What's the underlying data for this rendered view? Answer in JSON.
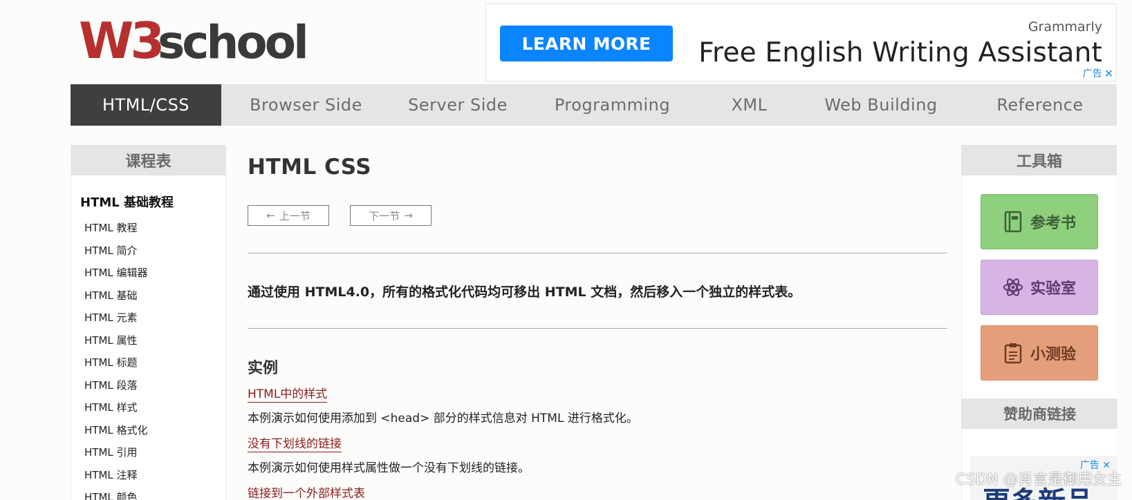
{
  "header": {
    "logo_text": "W3school"
  },
  "ad": {
    "button_label": "LEARN MORE",
    "brand": "Grammarly",
    "headline": "Free English Writing Assistant",
    "ad_mark": "广告"
  },
  "nav": {
    "items": [
      {
        "label": "HTML/CSS",
        "active": true
      },
      {
        "label": "Browser Side",
        "active": false
      },
      {
        "label": "Server Side",
        "active": false
      },
      {
        "label": "Programming",
        "active": false
      },
      {
        "label": "XML",
        "active": false
      },
      {
        "label": "Web Building",
        "active": false
      },
      {
        "label": "Reference",
        "active": false
      }
    ]
  },
  "left_sidebar": {
    "heading": "课程表",
    "group_title": "HTML 基础教程",
    "items": [
      "HTML 教程",
      "HTML 简介",
      "HTML 编辑器",
      "HTML 基础",
      "HTML 元素",
      "HTML 属性",
      "HTML 标题",
      "HTML 段落",
      "HTML 样式",
      "HTML 格式化",
      "HTML 引用",
      "HTML 注释",
      "HTML 颜色"
    ]
  },
  "main": {
    "title": "HTML CSS",
    "prev_label": "上一节",
    "next_label": "下一节",
    "intro": "通过使用 HTML4.0，所有的格式化代码均可移出 HTML 文档，然后移入一个独立的样式表。",
    "section_heading": "实例",
    "examples": [
      {
        "link": "HTML中的样式",
        "desc": "本例演示如何使用添加到 <head> 部分的样式信息对 HTML 进行格式化。"
      },
      {
        "link": "没有下划线的链接",
        "desc": "本例演示如何使用样式属性做一个没有下划线的链接。"
      },
      {
        "link": "链接到一个外部样式表",
        "desc": ""
      }
    ]
  },
  "right_sidebar": {
    "heading": "工具箱",
    "tools": [
      {
        "label": "参考书",
        "icon": "book-icon",
        "color": "#8ed07c"
      },
      {
        "label": "实验室",
        "icon": "atom-icon",
        "color": "#d7b4e6"
      },
      {
        "label": "小测验",
        "icon": "clipboard-icon",
        "color": "#e59e7c"
      }
    ],
    "sponsor_heading": "赞助商链接",
    "sponsor_ad_mark": "广告",
    "sponsor_ad_text": "更多新品"
  },
  "watermark": "CSDN @肖言是御用女主",
  "colors": {
    "nav_active_bg": "#3f3f3f",
    "nav_bg": "#e5e5e3",
    "link": "#8b1c1c",
    "ad_button": "#0a84ff"
  }
}
